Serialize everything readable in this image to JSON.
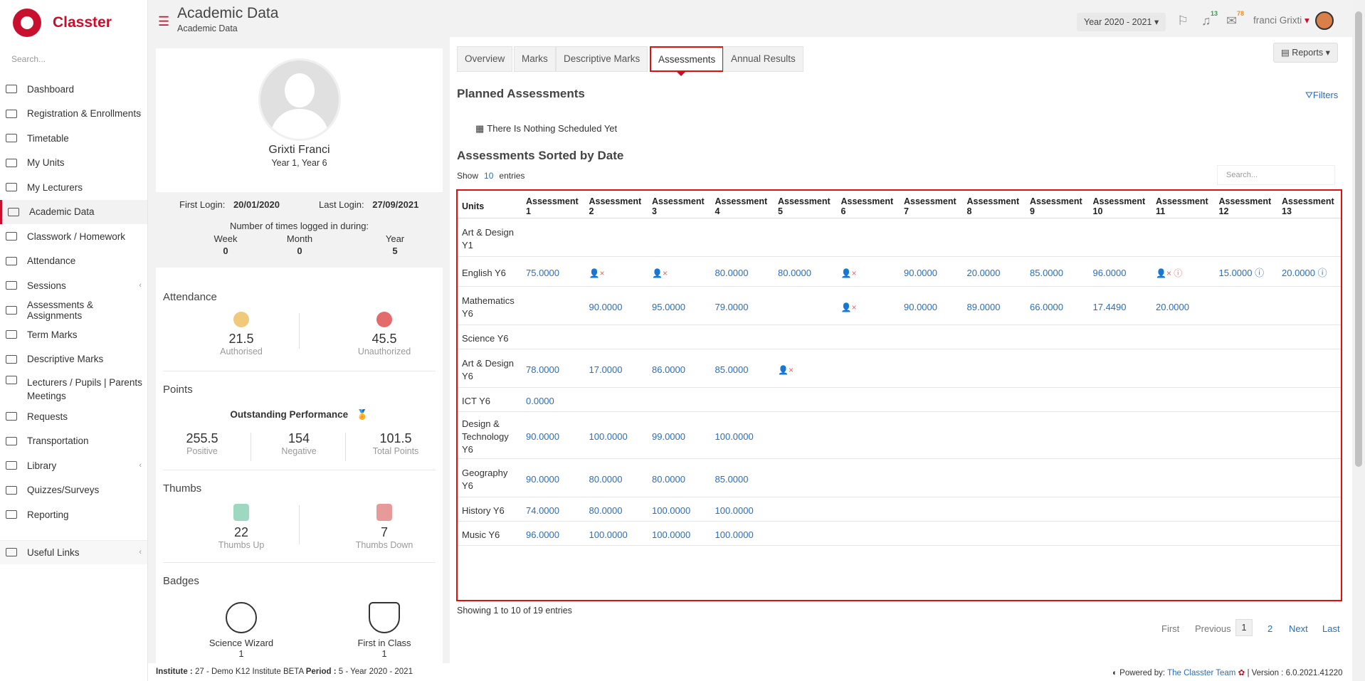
{
  "app": {
    "logo_text": "Classter",
    "search_placeholder": "Search..."
  },
  "sidebar": {
    "items": [
      {
        "label": "Dashboard"
      },
      {
        "label": "Registration & Enrollments"
      },
      {
        "label": "Timetable"
      },
      {
        "label": "My Units"
      },
      {
        "label": "My Lecturers"
      },
      {
        "label": "Academic Data"
      },
      {
        "label": "Classwork / Homework"
      },
      {
        "label": "Attendance"
      },
      {
        "label": "Sessions"
      },
      {
        "label": "Assessments & Assignments"
      },
      {
        "label": "Term Marks"
      },
      {
        "label": "Descriptive Marks"
      },
      {
        "label": "Lecturers / Pupils | Parents Meetings"
      },
      {
        "label": "Requests"
      },
      {
        "label": "Transportation"
      },
      {
        "label": "Library"
      },
      {
        "label": "Quizzes/Surveys"
      },
      {
        "label": "Reporting"
      }
    ],
    "useful_links": "Useful Links"
  },
  "header": {
    "title": "Academic Data",
    "subtitle": "Academic Data",
    "year": "Year 2020 - 2021",
    "notif_count": "13",
    "mail_count": "78",
    "user_name": "franci Grixti"
  },
  "profile": {
    "name": "Grixti Franci",
    "class": "Year 1, Year 6",
    "first_login_label": "First Login:",
    "first_login": "20/01/2020",
    "last_login_label": "Last Login:",
    "last_login": "27/09/2021",
    "times_label": "Number of times logged in during:",
    "week_label": "Week",
    "week": "0",
    "month_label": "Month",
    "month": "0",
    "year_label": "Year",
    "year": "5",
    "attendance_title": "Attendance",
    "authorised": "21.5",
    "authorised_label": "Authorised",
    "unauthorized": "45.5",
    "unauthorized_label": "Unauthorized",
    "points_title": "Points",
    "performance": "Outstanding Performance",
    "positive": "255.5",
    "positive_label": "Positive",
    "negative": "154",
    "negative_label": "Negative",
    "total": "101.5",
    "total_label": "Total Points",
    "thumbs_title": "Thumbs",
    "thumbs_up": "22",
    "thumbs_up_label": "Thumbs Up",
    "thumbs_down": "7",
    "thumbs_down_label": "Thumbs Down",
    "badges_title": "Badges",
    "badge1": "Science Wizard",
    "badge1_count": "1",
    "badge2": "First in Class",
    "badge2_count": "1"
  },
  "tabs": [
    {
      "label": "Overview"
    },
    {
      "label": "Marks"
    },
    {
      "label": "Descriptive Marks"
    },
    {
      "label": "Assessments"
    },
    {
      "label": "Annual Results"
    }
  ],
  "main": {
    "reports": "Reports",
    "planned_title": "Planned Assessments",
    "filters": "Filters",
    "nothing": "There Is Nothing Scheduled Yet",
    "sorted_title": "Assessments Sorted by Date",
    "show": "Show",
    "entries_count": "10",
    "entries": "entries",
    "search_placeholder": "Search...",
    "showing": "Showing 1 to 10 of 19 entries",
    "pager": {
      "first": "First",
      "previous": "Previous",
      "p1": "1",
      "p2": "2",
      "next": "Next",
      "last": "Last"
    }
  },
  "table": {
    "units_header": "Units",
    "headers": [
      "Assessment 1",
      "Assessment 2",
      "Assessment 3",
      "Assessment 4",
      "Assessment 5",
      "Assessment 6",
      "Assessment 7",
      "Assessment 8",
      "Assessment 9",
      "Assessment 10",
      "Assessment 11",
      "Assessment 12",
      "Assessment 13"
    ],
    "rows": [
      {
        "unit": "Art & Design Y1",
        "cells": [
          "",
          "",
          "",
          "",
          "",
          "",
          "",
          "",
          "",
          "",
          "",
          "",
          ""
        ]
      },
      {
        "unit": "English Y6",
        "cells": [
          "75.0000",
          "absent",
          "absent",
          "80.0000",
          "80.0000",
          "absent",
          "90.0000",
          "20.0000",
          "85.0000",
          "96.0000",
          "absent-info",
          "15.0000 ⓘ",
          "20.0000 ⓘ"
        ]
      },
      {
        "unit": "Mathematics Y6",
        "cells": [
          "",
          "90.0000",
          "95.0000",
          "79.0000",
          "",
          "absent",
          "90.0000",
          "89.0000",
          "66.0000",
          "17.4490",
          "20.0000",
          "",
          ""
        ]
      },
      {
        "unit": "Science Y6",
        "cells": [
          "",
          "",
          "",
          "",
          "",
          "",
          "",
          "",
          "",
          "",
          "",
          "",
          ""
        ]
      },
      {
        "unit": "Art & Design Y6",
        "cells": [
          "78.0000",
          "17.0000",
          "86.0000",
          "85.0000",
          "absent",
          "",
          "",
          "",
          "",
          "",
          "",
          "",
          ""
        ]
      },
      {
        "unit": "ICT Y6",
        "cells": [
          "0.0000",
          "",
          "",
          "",
          "",
          "",
          "",
          "",
          "",
          "",
          "",
          "",
          ""
        ]
      },
      {
        "unit": "Design & Technology Y6",
        "cells": [
          "90.0000",
          "100.0000",
          "99.0000",
          "100.0000",
          "",
          "",
          "",
          "",
          "",
          "",
          "",
          "",
          ""
        ]
      },
      {
        "unit": "Geography Y6",
        "cells": [
          "90.0000",
          "80.0000",
          "80.0000",
          "85.0000",
          "",
          "",
          "",
          "",
          "",
          "",
          "",
          "",
          ""
        ]
      },
      {
        "unit": "History Y6",
        "cells": [
          "74.0000",
          "80.0000",
          "100.0000",
          "100.0000",
          "",
          "",
          "",
          "",
          "",
          "",
          "",
          "",
          ""
        ]
      },
      {
        "unit": "Music Y6",
        "cells": [
          "96.0000",
          "100.0000",
          "100.0000",
          "100.0000",
          "",
          "",
          "",
          "",
          "",
          "",
          "",
          "",
          ""
        ]
      }
    ]
  },
  "footer": {
    "institute_label": "Institute :",
    "institute": "27 - Demo K12 Institute BETA",
    "period_label": "Period :",
    "period": "5 - Year 2020 - 2021",
    "powered": "Powered by:",
    "team": "The Classter Team",
    "version": "| Version : 6.0.2021.41220"
  },
  "colors": {
    "brand": "#c8102e",
    "link": "#2a6ebb",
    "highlight": "#e01010"
  }
}
